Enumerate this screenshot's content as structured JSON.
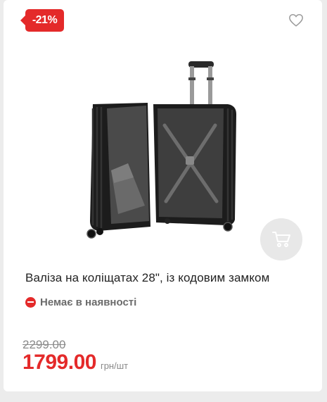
{
  "product": {
    "discount_badge": "-21%",
    "title": "Валіза на коліщатах 28\", із кодовим замком",
    "availability": "Немає в наявності",
    "old_price": "2299.00",
    "price": "1799.00",
    "price_unit": "грн/шт"
  },
  "icons": {
    "wishlist": "heart-outline-icon",
    "cart": "shopping-cart-icon",
    "availability": "minus-circle-icon"
  },
  "colors": {
    "accent": "#e42a2a",
    "muted_text": "#8a8a8a",
    "cart_button_bg": "#e8e8e8"
  }
}
